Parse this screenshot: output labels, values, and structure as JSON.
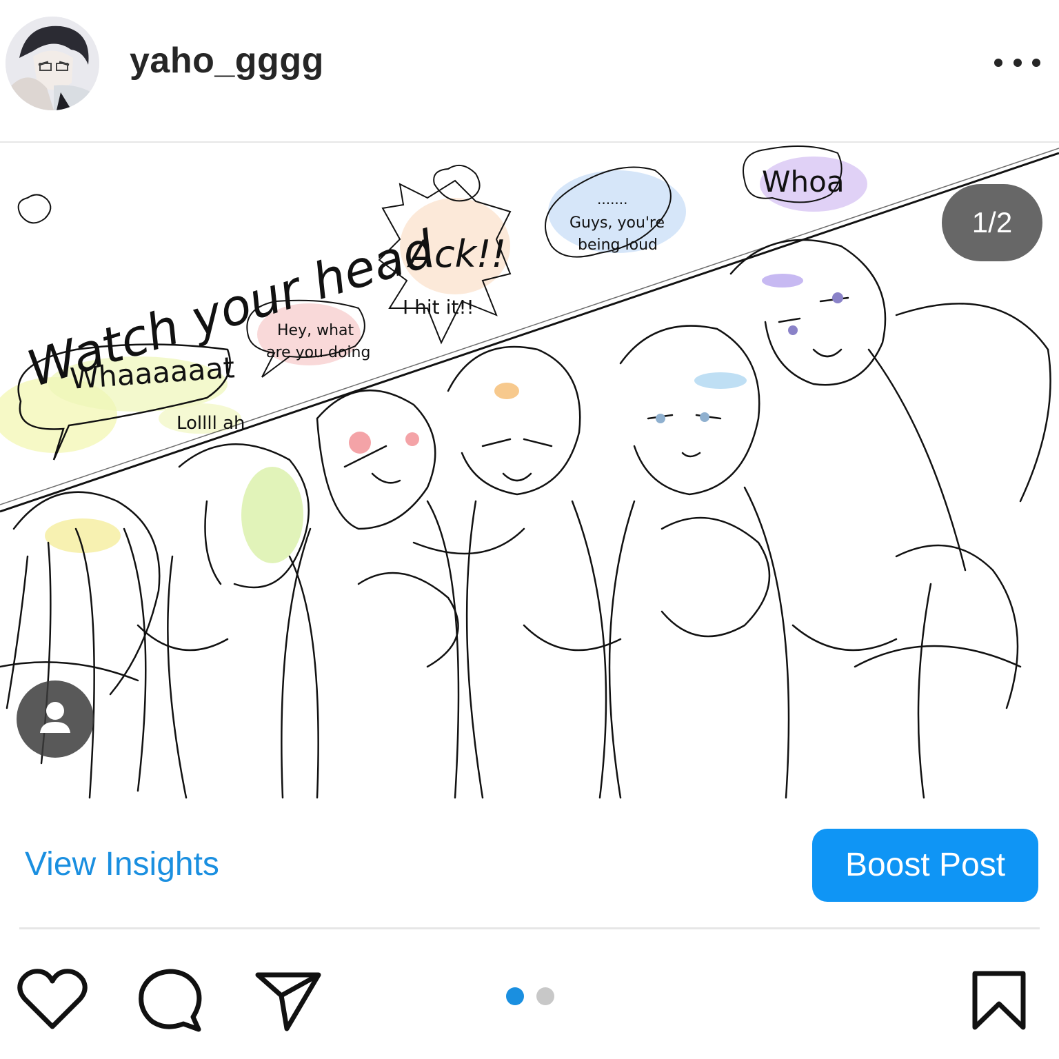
{
  "post": {
    "username": "yaho_gggg",
    "image_counter": "1/2",
    "artwork": {
      "title_text": "Watch your head",
      "bubbles": {
        "whoa": "Whoa",
        "ack": "Ack!!",
        "hit": "I hit it!!",
        "dots": ".......",
        "loud_line1": "Guys, you're",
        "loud_line2": "being loud",
        "hey_line1": "Hey, what",
        "hey_line2": "are you doing",
        "whaat": "Whaaaaaat",
        "loll": "Lollll ah"
      }
    }
  },
  "actions": {
    "view_insights": "View Insights",
    "boost_post": "Boost Post"
  },
  "icons": {
    "more": "more-horizontal-icon",
    "tag": "user-tag-icon",
    "like": "heart-icon",
    "comment": "comment-icon",
    "share": "send-icon",
    "save": "bookmark-icon"
  },
  "carousel": {
    "active_index": 0,
    "count": 2
  },
  "colors": {
    "accent_blue": "#0f95f5",
    "link_blue": "#1a8fe0",
    "dot_active": "#1a8fe0",
    "dot_inactive": "#c8c8c8",
    "counter_bg": "#464646"
  }
}
